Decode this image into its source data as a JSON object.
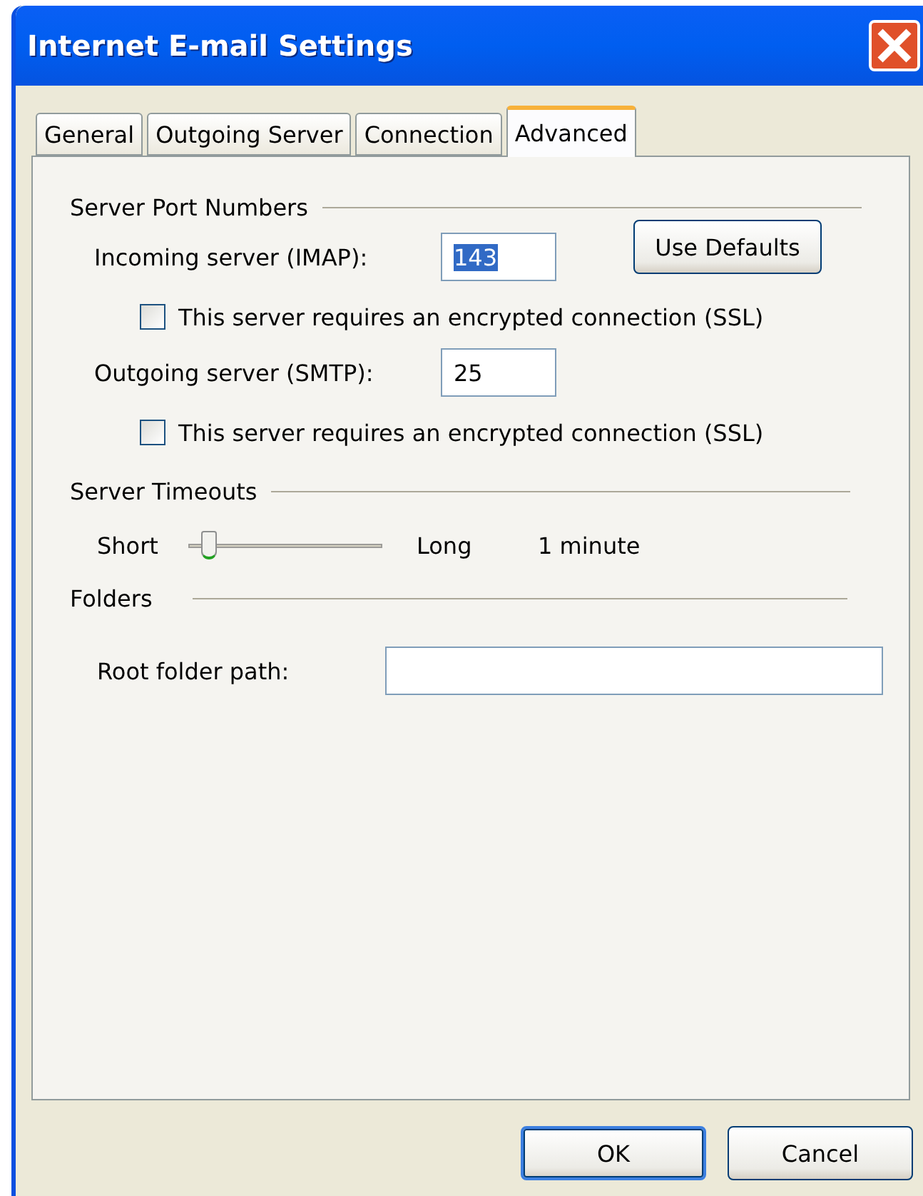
{
  "window": {
    "title": "Internet E-mail Settings"
  },
  "tabs": [
    {
      "label": "General",
      "selected": false
    },
    {
      "label": "Outgoing Server",
      "selected": false
    },
    {
      "label": "Connection",
      "selected": false
    },
    {
      "label": "Advanced",
      "selected": true
    }
  ],
  "server_ports": {
    "heading": "Server Port Numbers",
    "use_defaults_button": "Use Defaults",
    "ports": [
      {
        "label": "Incoming server (IMAP):",
        "value": "143",
        "text_selected": true,
        "ssl": {
          "label": "This server requires an encrypted connection (SSL)",
          "checked": false
        }
      },
      {
        "label": "Outgoing server (SMTP):",
        "value": "25",
        "text_selected": false,
        "ssl": {
          "label": "This server requires an encrypted connection (SSL)",
          "checked": false
        }
      }
    ]
  },
  "server_timeouts": {
    "heading": "Server Timeouts",
    "min_label": "Short",
    "max_label": "Long",
    "level": 0.1,
    "reading": "1 minute"
  },
  "folders": {
    "heading": "Folders",
    "root_folder_label": "Root folder path:"
  },
  "buttons": [
    {
      "label": "OK",
      "default": true
    },
    {
      "label": "Cancel",
      "default": false
    }
  ]
}
